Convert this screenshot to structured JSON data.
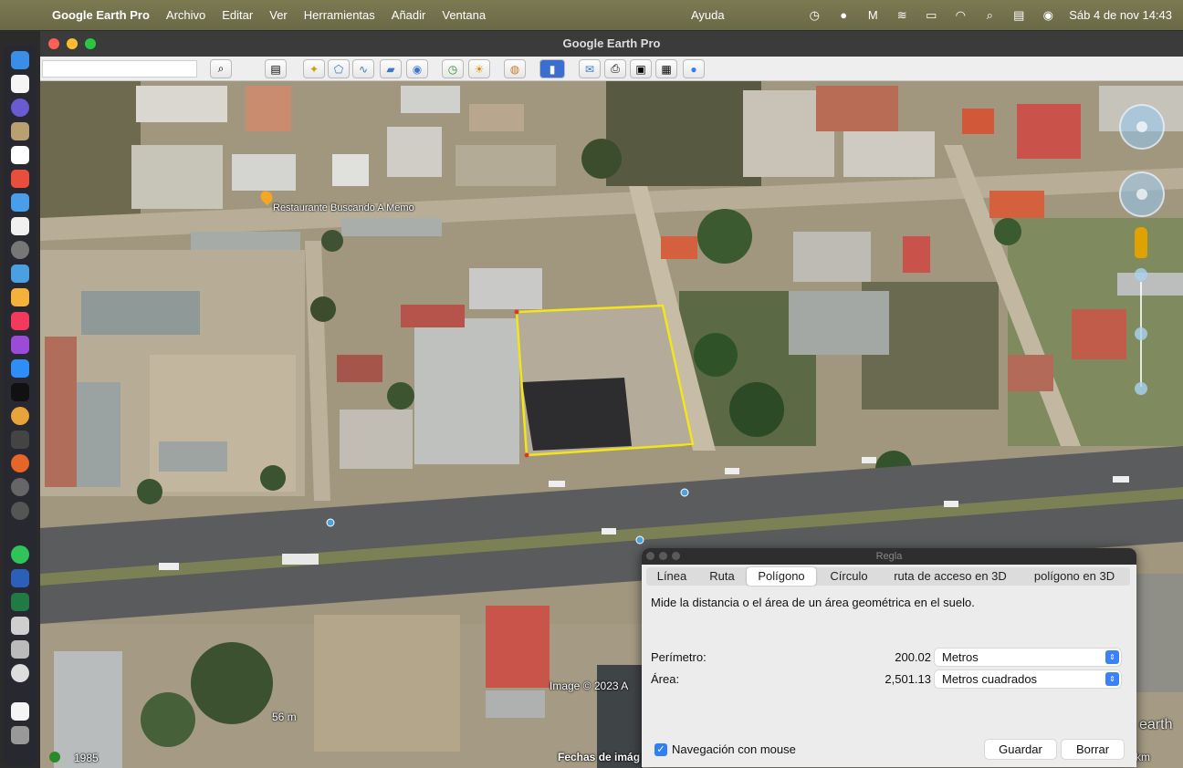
{
  "menubar": {
    "app_name": "Google Earth Pro",
    "items": [
      "Archivo",
      "Editar",
      "Ver",
      "Herramientas",
      "Añadir",
      "Ventana"
    ],
    "help": "Ayuda",
    "clock": "Sáb 4 de nov  14:43"
  },
  "window": {
    "title": "Google Earth Pro"
  },
  "map": {
    "place_label": "Restaurante Buscando A Memo",
    "copyright": "Image © 2023 A",
    "scale_label": "56 m",
    "imagery_date": "Fechas de imág",
    "year": "1985",
    "km_fragment": "km",
    "watermark": "earth"
  },
  "ruler": {
    "title": "Regla",
    "tabs": [
      "Línea",
      "Ruta",
      "Polígono",
      "Círculo",
      "ruta de acceso en 3D",
      "polígono en 3D"
    ],
    "active_tab": "Polígono",
    "description": "Mide la distancia o el área de un área geométrica en el suelo.",
    "perimeter_label": "Perímetro:",
    "perimeter_value": "200.02",
    "perimeter_unit": "Metros",
    "area_label": "Área:",
    "area_value": "2,501.13",
    "area_unit": "Metros cuadrados",
    "mouse_nav_label": "Navegación con mouse",
    "mouse_nav_checked": true,
    "save_label": "Guardar",
    "clear_label": "Borrar"
  },
  "colors": {
    "polygon": "#f2e51a",
    "accent": "#2f7ff5"
  }
}
